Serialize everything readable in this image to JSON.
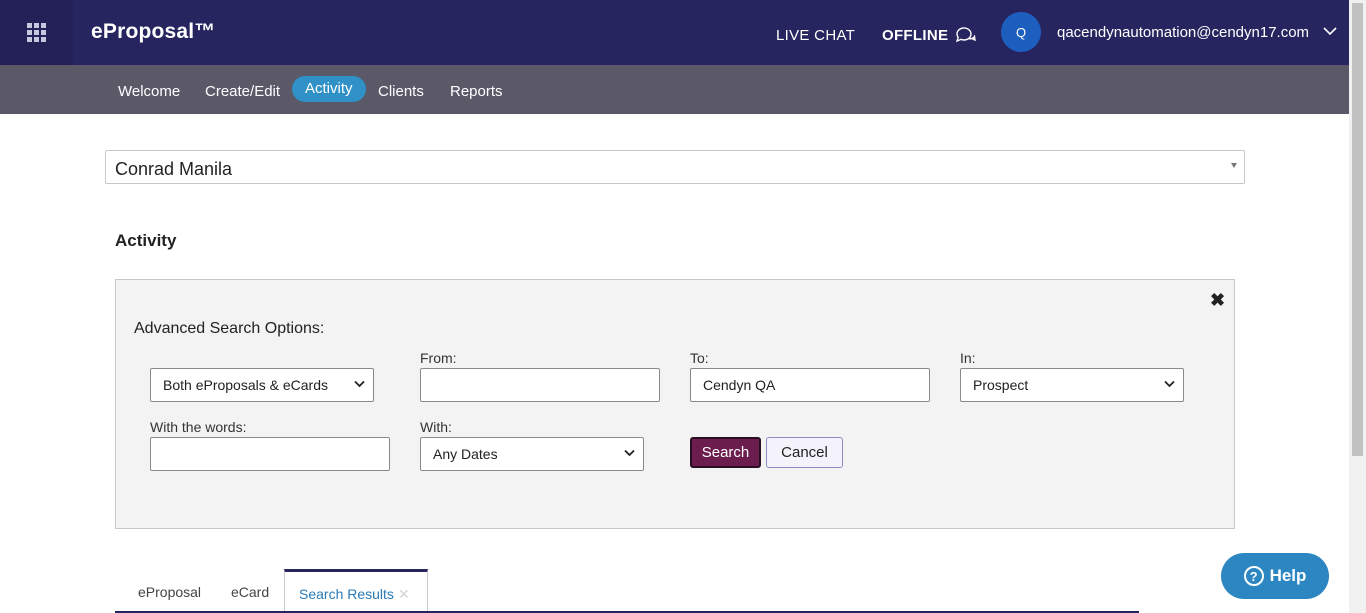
{
  "header": {
    "brand": "eProposal™",
    "live_chat": "LIVE CHAT",
    "offline": "OFFLINE",
    "avatar_initial": "Q",
    "user_email": "qacendynautomation@cendyn17.com"
  },
  "nav": {
    "items": [
      {
        "label": "Welcome"
      },
      {
        "label": "Create/Edit"
      },
      {
        "label": "Activity"
      },
      {
        "label": "Clients"
      },
      {
        "label": "Reports"
      }
    ],
    "active": "Activity"
  },
  "property": {
    "selected": "Conrad Manila"
  },
  "page": {
    "title": "Activity"
  },
  "advanced_search": {
    "title": "Advanced Search Options:",
    "type_select": "Both eProposals & eCards",
    "from_label": "From:",
    "from_value": "",
    "to_label": "To:",
    "to_value": "Cendyn QA",
    "in_label": "In:",
    "in_select": "Prospect",
    "words_label": "With the words:",
    "words_value": "",
    "with_label": "With:",
    "with_select": "Any Dates",
    "search_button": "Search",
    "cancel_button": "Cancel"
  },
  "tabs": [
    {
      "label": "eProposal"
    },
    {
      "label": "eCard"
    },
    {
      "label": "Search Results"
    }
  ],
  "help": {
    "label": "Help"
  },
  "colors": {
    "header_bg": "#27255f",
    "nav_bg": "#5b5868",
    "nav_active": "#3091c7",
    "search_button": "#6b1d4e",
    "help_button": "#2c86c1"
  },
  "icons": {
    "app_grid": "app-grid-icon",
    "chat": "chat-bubble-icon",
    "user_menu": "chevron-down-icon",
    "close": "close-icon",
    "help": "question-circle-icon"
  }
}
